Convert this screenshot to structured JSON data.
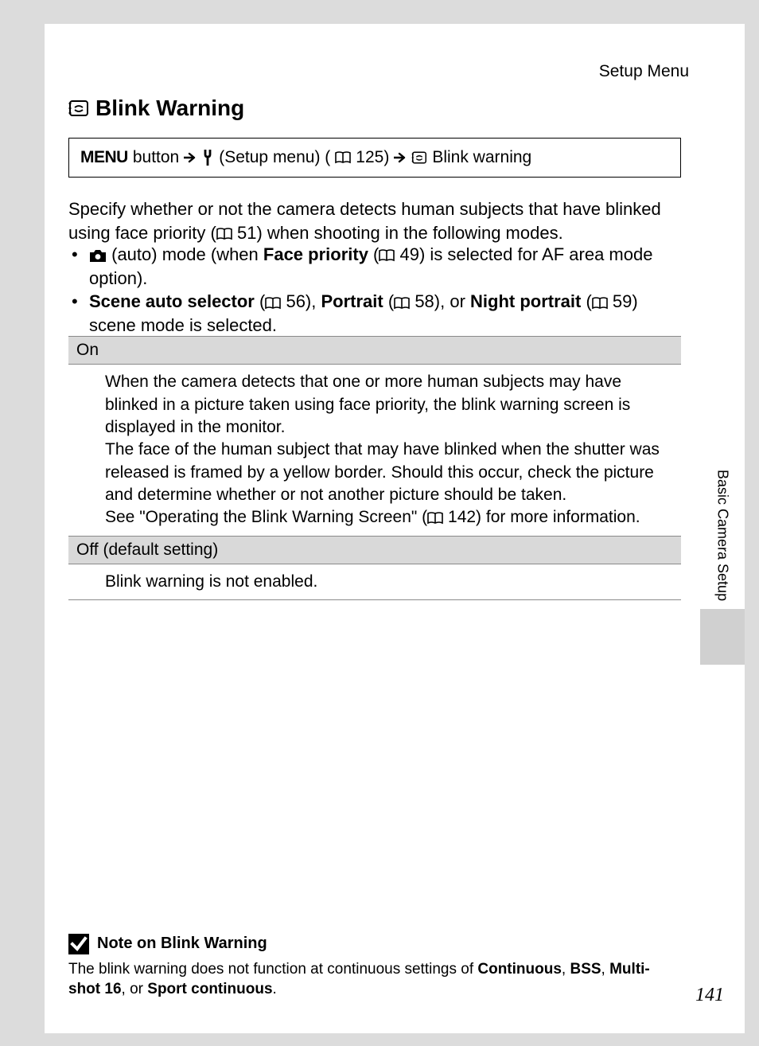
{
  "section_label": "Setup Menu",
  "heading": "Blink Warning",
  "nav": {
    "menu_word": "MENU",
    "button_word": "button",
    "setup_menu_label": "(Setup menu) (",
    "ref125": "125)",
    "blink_label": "Blink warning"
  },
  "intro": {
    "part1": "Specify whether or not the camera detects human subjects that have blinked using face priority (",
    "ref51": "51) when shooting in the following modes."
  },
  "bullets": {
    "b1": {
      "p1": "(auto) mode (when ",
      "face_priority": "Face priority",
      "p2": " (",
      "ref49": "49) is selected for AF area mode option)."
    },
    "b2": {
      "scene_auto": "Scene auto selector",
      "p1": " (",
      "ref56": "56), ",
      "portrait": "Portrait",
      "p2": " (",
      "ref58": "58), or ",
      "night": "Night portrait",
      "p3": " (",
      "ref59": "59) scene mode is selected."
    }
  },
  "options": {
    "on": {
      "label": "On",
      "body1": "When the camera detects that one or more human subjects may have blinked in a picture taken using face priority, the blink warning screen is displayed in the monitor.",
      "body2": "The face of the human subject that may have blinked when the shutter was released is framed by a yellow border. Should this occur, check the picture and determine whether or not another picture should be taken.",
      "body3a": "See \"Operating the Blink Warning Screen\" (",
      "ref142": "142) for more information."
    },
    "off": {
      "label": "Off (default setting)",
      "body": "Blink warning is not enabled."
    }
  },
  "side_label": "Basic Camera Setup",
  "note": {
    "title": "Note on Blink Warning",
    "body_pre": "The blink warning does not function at continuous settings of ",
    "continuous": "Continuous",
    "sep1": ", ",
    "bss": "BSS",
    "sep2": ", ",
    "multishot": "Multi-shot 16",
    "sep3": ", or ",
    "sport": "Sport continuous",
    "period": "."
  },
  "page_number": "141"
}
